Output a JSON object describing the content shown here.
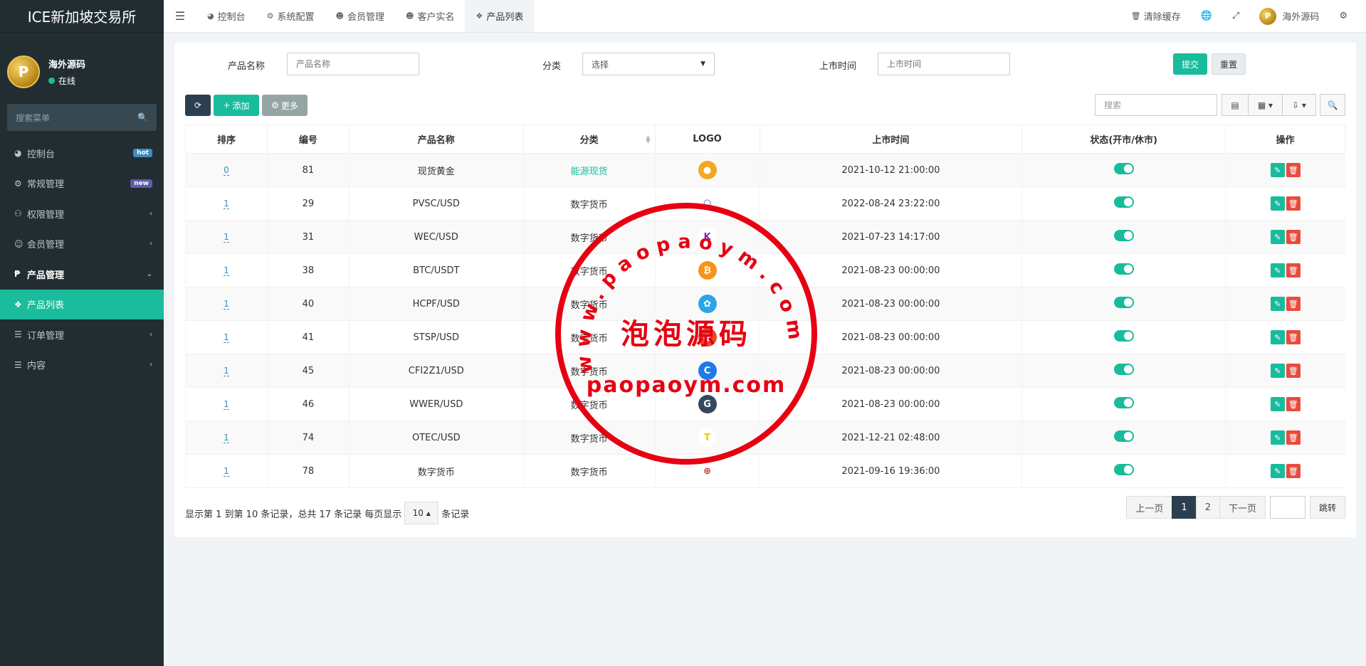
{
  "app": {
    "title": "ICE新加坡交易所",
    "user_name": "海外源码",
    "user_status": "在线"
  },
  "sidebar": {
    "search_placeholder": "搜索菜单",
    "items": [
      {
        "label": "控制台",
        "icon": "dashboard-icon",
        "badge": "hot"
      },
      {
        "label": "常规管理",
        "icon": "cogs-icon",
        "badge": "new"
      },
      {
        "label": "权限管理",
        "icon": "users-icon",
        "chevron": "‹"
      },
      {
        "label": "会员管理",
        "icon": "user-circle-icon",
        "chevron": "‹"
      },
      {
        "label": "产品管理",
        "icon": "product-icon",
        "chevron": "⌄"
      },
      {
        "label": "产品列表",
        "icon": "cubes-icon"
      },
      {
        "label": "订单管理",
        "icon": "list-icon",
        "chevron": "‹"
      },
      {
        "label": "内容",
        "icon": "list-icon",
        "chevron": "‹"
      }
    ]
  },
  "topbar": {
    "tabs": [
      {
        "label": "控制台",
        "icon": "dashboard-icon"
      },
      {
        "label": "系统配置",
        "icon": "cog-icon"
      },
      {
        "label": "会员管理",
        "icon": "user-icon"
      },
      {
        "label": "客户实名",
        "icon": "user-icon"
      },
      {
        "label": "产品列表",
        "icon": "cubes-icon"
      }
    ],
    "clear_cache": "清除缓存",
    "user_name": "海外源码"
  },
  "filter": {
    "name_label": "产品名称",
    "name_placeholder": "产品名称",
    "category_label": "分类",
    "category_value": "选择",
    "time_label": "上市时间",
    "time_placeholder": "上市时间",
    "submit": "提交",
    "reset": "重置"
  },
  "toolbar": {
    "add": "添加",
    "more": "更多",
    "search_placeholder": "搜索"
  },
  "table": {
    "columns": [
      "排序",
      "编号",
      "产品名称",
      "分类",
      "LOGO",
      "上市时间",
      "状态(开市/休市)",
      "操作"
    ],
    "rows": [
      {
        "sort": "0",
        "id": "81",
        "name": "现货黄金",
        "category": "能源现货",
        "time": "2021-10-12 21:00:00"
      },
      {
        "sort": "1",
        "id": "29",
        "name": "PVSC/USD",
        "category": "数字货币",
        "time": "2022-08-24 23:22:00"
      },
      {
        "sort": "1",
        "id": "31",
        "name": "WEC/USD",
        "category": "数字货币",
        "time": "2021-07-23 14:17:00"
      },
      {
        "sort": "1",
        "id": "38",
        "name": "BTC/USDT",
        "category": "数字货币",
        "time": "2021-08-23 00:00:00"
      },
      {
        "sort": "1",
        "id": "40",
        "name": "HCPF/USD",
        "category": "数字货币",
        "time": "2021-08-23 00:00:00"
      },
      {
        "sort": "1",
        "id": "41",
        "name": "STSP/USD",
        "category": "数字货币",
        "time": "2021-08-23 00:00:00"
      },
      {
        "sort": "1",
        "id": "45",
        "name": "CFI2Z1/USD",
        "category": "数字货币",
        "time": "2021-08-23 00:00:00"
      },
      {
        "sort": "1",
        "id": "46",
        "name": "WWER/USD",
        "category": "数字货币",
        "time": "2021-08-23 00:00:00"
      },
      {
        "sort": "1",
        "id": "74",
        "name": "OTEC/USD",
        "category": "数字货币",
        "time": "2021-12-21 02:48:00"
      },
      {
        "sort": "1",
        "id": "78",
        "name": "数字货币",
        "category": "数字货币",
        "time": "2021-09-16 19:36:00"
      }
    ]
  },
  "footer": {
    "info_prefix": "显示第 1 到第 10 条记录，总共 17 条记录 每页显示",
    "per_page": "10",
    "info_suffix": "条记录",
    "prev": "上一页",
    "page1": "1",
    "page2": "2",
    "next": "下一页",
    "go": "跳转"
  },
  "watermark": {
    "arc_text": "www.paopaoym.com",
    "center_text": "泡泡源码",
    "bottom_text": "paopaoym.com"
  },
  "colors": {
    "accent": "#18bc9c",
    "sidebar_bg": "#222d32",
    "danger": "#e74c3c",
    "stamp_red": "#e60012"
  }
}
